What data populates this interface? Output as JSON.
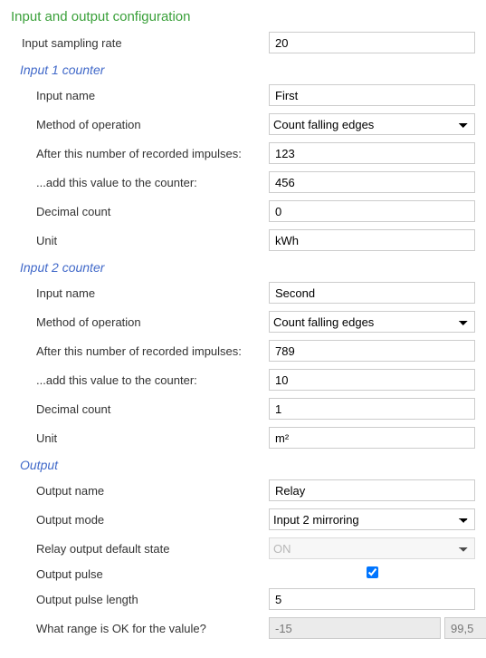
{
  "title": "Input and output configuration",
  "samplingRate": {
    "label": "Input sampling rate",
    "value": "20"
  },
  "input1": {
    "heading": "Input 1 counter",
    "name": {
      "label": "Input name",
      "value": "First"
    },
    "method": {
      "label": "Method of operation",
      "selected": "Count falling edges"
    },
    "afterImpulses": {
      "label": "After this number of recorded impulses:",
      "value": "123"
    },
    "addValue": {
      "label": "...add this value to the counter:",
      "value": "456"
    },
    "decimalCount": {
      "label": "Decimal count",
      "value": "0"
    },
    "unit": {
      "label": "Unit",
      "value": "kWh"
    }
  },
  "input2": {
    "heading": "Input 2 counter",
    "name": {
      "label": "Input name",
      "value": "Second"
    },
    "method": {
      "label": "Method of operation",
      "selected": "Count falling edges"
    },
    "afterImpulses": {
      "label": "After this number of recorded impulses:",
      "value": "789"
    },
    "addValue": {
      "label": "...add this value to the counter:",
      "value": "10"
    },
    "decimalCount": {
      "label": "Decimal count",
      "value": "1"
    },
    "unit": {
      "label": "Unit",
      "value": "m²"
    }
  },
  "output": {
    "heading": "Output",
    "name": {
      "label": "Output name",
      "value": "Relay"
    },
    "mode": {
      "label": "Output mode",
      "selected": "Input 2 mirroring"
    },
    "defaultState": {
      "label": "Relay output default state",
      "selected": "ON"
    },
    "pulse": {
      "label": "Output pulse",
      "checked": true
    },
    "pulseLength": {
      "label": "Output pulse length",
      "value": "5"
    },
    "range": {
      "label": "What range is OK for the valule?",
      "low": "-15",
      "high": "99,5"
    }
  }
}
